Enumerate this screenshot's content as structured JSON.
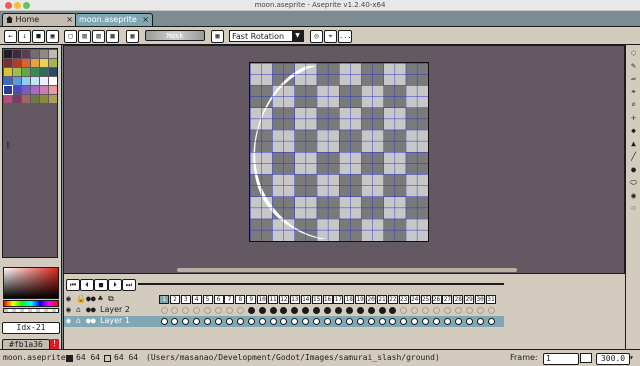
{
  "window": {
    "title": "moon.aseprite - Aseprite v1.2.40-x64"
  },
  "tabs": [
    {
      "label": "Home",
      "close": "×"
    },
    {
      "label": "moon.aseprite",
      "close": "×"
    }
  ],
  "toolbar": {
    "mask_label": "Mask",
    "rotation_select": "Fast Rotation",
    "more_label": "..."
  },
  "left": {
    "index_label": "Idx-21",
    "hex_label": "#fb1a36",
    "warning_icon": "!"
  },
  "layers": [
    {
      "name": "Layer 2"
    },
    {
      "name": "Layer 1"
    }
  ],
  "frames": [
    "1",
    "2",
    "3",
    "4",
    "5",
    "6",
    "7",
    "8",
    "9",
    "10",
    "11",
    "12",
    "13",
    "14",
    "15",
    "16",
    "17",
    "18",
    "19",
    "20",
    "21",
    "22",
    "23",
    "24",
    "25",
    "26",
    "27",
    "28",
    "29",
    "30",
    "31"
  ],
  "status": {
    "filename": "moon.aseprite",
    "size_a": "64 64",
    "size_b": "64 64",
    "path": "(Users/masanao/Development/Godot/Images/samurai_slash/ground)",
    "frame_label": "Frame:",
    "frame_value": "1",
    "zoom_value": "300.0"
  },
  "colors": {
    "accent_blue": "#2b32c8",
    "bg_dark": "#645963",
    "panel": "#d3cbbe",
    "selected_cel": "#7fa8b4",
    "red_warning": "#d81c20"
  }
}
